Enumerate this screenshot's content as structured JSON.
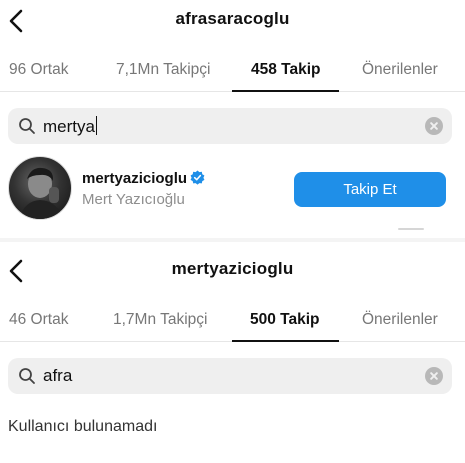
{
  "screen_1": {
    "title": "afrasaracoglu",
    "tabs": [
      {
        "label": "96 Ortak",
        "active": false
      },
      {
        "label": "7,1Mn Takipçi",
        "active": false
      },
      {
        "label": "458 Takip",
        "active": true
      },
      {
        "label": "Önerilenler",
        "active": false
      }
    ],
    "search": {
      "query": "mertya"
    },
    "result": {
      "username": "mertyazicioglu",
      "full_name": "Mert Yazıcıoğlu",
      "verified": true,
      "follow_label": "Takip Et"
    }
  },
  "screen_2": {
    "title": "mertyazicioglu",
    "tabs": [
      {
        "label": "46 Ortak",
        "active": false
      },
      {
        "label": "1,7Mn Takipçi",
        "active": false
      },
      {
        "label": "500 Takip",
        "active": true
      },
      {
        "label": "Önerilenler",
        "active": false
      }
    ],
    "search": {
      "query": "afra"
    },
    "empty_message": "Kullanıcı bulunamadı"
  },
  "colors": {
    "accent": "#1f8fe8",
    "verified": "#1f8fe8",
    "muted_text": "#8e8e8e",
    "search_bg": "#efefef"
  },
  "icons": [
    "chevron-left-icon",
    "search-icon",
    "clear-icon",
    "verified-badge-icon"
  ]
}
